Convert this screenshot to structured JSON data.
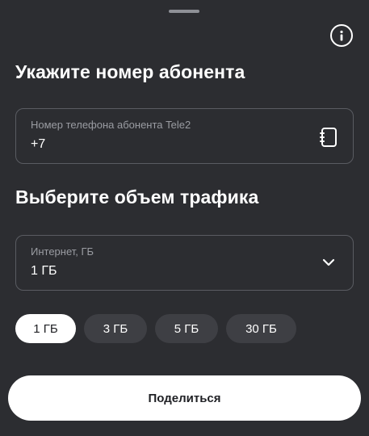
{
  "sheet": {
    "handle_icon": "drag-handle",
    "info_icon": "info-icon"
  },
  "subscriber": {
    "heading": "Укажите номер абонента",
    "phone_label": "Номер телефона абонента Tele2",
    "phone_value": "+7",
    "contacts_icon": "address-book-icon"
  },
  "traffic": {
    "heading": "Выберите объем трафика",
    "select_label": "Интернет, ГБ",
    "select_value": "1 ГБ",
    "dropdown_icon": "chevron-down-icon",
    "options": [
      {
        "label": "1 ГБ",
        "selected": true
      },
      {
        "label": "3 ГБ",
        "selected": false
      },
      {
        "label": "5 ГБ",
        "selected": false
      },
      {
        "label": "30 ГБ",
        "selected": false
      }
    ]
  },
  "actions": {
    "share_label": "Поделиться"
  },
  "colors": {
    "background": "#2c2d31",
    "chip_inactive": "#3e3f44",
    "chip_active": "#ffffff",
    "border": "#5a5c62",
    "label": "#9a9ca2"
  }
}
